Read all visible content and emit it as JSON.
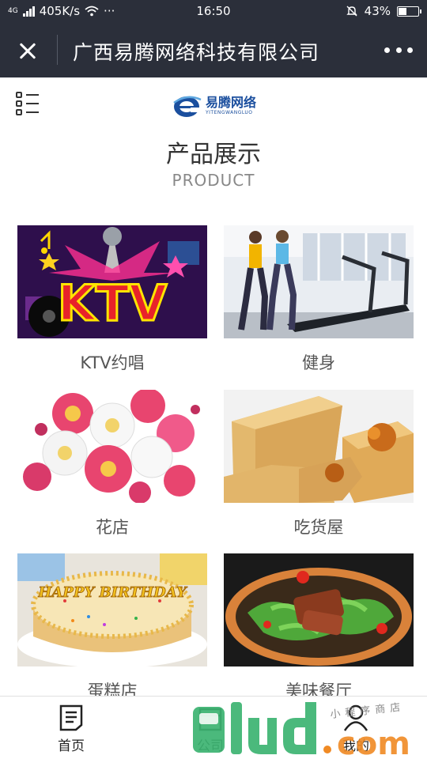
{
  "status_bar": {
    "network": "4G",
    "speed": "405K/s",
    "more": "···",
    "time": "16:50",
    "battery_percent": "43%",
    "battery_level": 0.43
  },
  "title_bar": {
    "title": "广西易腾网络科技有限公司"
  },
  "header": {
    "logo_cn": "易腾网络",
    "logo_en": "YITENGWANGLUO",
    "section_title": "产品展示",
    "section_subtitle": "PRODUCT"
  },
  "products": [
    {
      "label": "KTV约唱",
      "image": "ktv-image"
    },
    {
      "label": "健身",
      "image": "gym-image"
    },
    {
      "label": "花店",
      "image": "flowers-image"
    },
    {
      "label": "吃货屋",
      "image": "pastry-image"
    },
    {
      "label": "蛋糕店",
      "image": "cake-image"
    },
    {
      "label": "美味餐厅",
      "image": "dish-image"
    }
  ],
  "ktv_text": "KTV",
  "cake_text": "HAPPY BIRTHDAY",
  "tab_bar": {
    "tabs": [
      {
        "label": "首页",
        "icon": "document-icon"
      },
      {
        "label": "公司",
        "icon": "building-icon"
      },
      {
        "label": "我的",
        "icon": "user-icon"
      }
    ]
  },
  "watermark": {
    "text": "9lud.com",
    "tagline": "小程序商店"
  },
  "colors": {
    "bar_bg": "#2b2f3a",
    "logo_blue": "#1b4f9e",
    "watermark_green": "#3cb371",
    "watermark_orange": "#f08a24"
  }
}
